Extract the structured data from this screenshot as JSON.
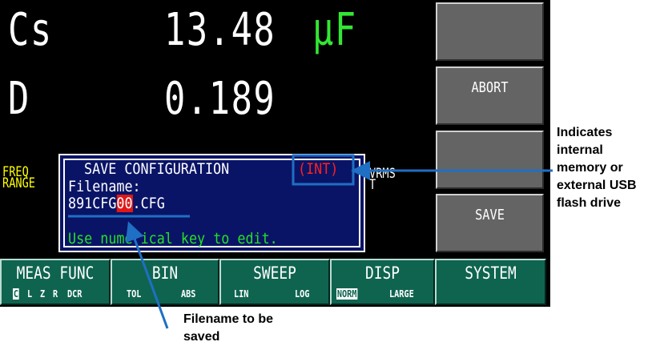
{
  "readings": {
    "param1": "Cs",
    "value1": "13.48",
    "unit1": "µF",
    "param2": "D",
    "value2": "0.189"
  },
  "labels": {
    "freq": "FREQ",
    "range": "RANGE",
    "vrms": "VRMS",
    "t": "T"
  },
  "side_buttons": [
    "",
    "ABORT",
    "",
    "SAVE"
  ],
  "dialog": {
    "title": "SAVE CONFIGURATION",
    "storage": "(INT)",
    "filename_label": "Filename:",
    "filename_prefix": "891CFG",
    "filename_cursor": "00",
    "filename_suffix": ".CFG",
    "hint": "Use numerical key to edit."
  },
  "bottom_menu": {
    "meas_func": {
      "label": "MEAS FUNC",
      "options": [
        "C",
        "L",
        "Z",
        "R",
        "DCR"
      ]
    },
    "bin": {
      "label": "BIN",
      "options": [
        "TOL",
        "ABS"
      ]
    },
    "sweep": {
      "label": "SWEEP",
      "options": [
        "LIN",
        "LOG"
      ]
    },
    "disp": {
      "label": "DISP",
      "options": [
        "NORM",
        "LARGE"
      ]
    },
    "system": {
      "label": "SYSTEM"
    }
  },
  "annotations": {
    "storage": "Indicates internal memory or external USB flash drive",
    "filename": "Filename to be saved"
  },
  "colors": {
    "screen_bg": "#000000",
    "unit_green": "#33e633",
    "freq_yellow": "#ffff00",
    "dialog_bg": "#0a1466",
    "int_red": "#ff2020",
    "hint_green": "#26e026",
    "menu_teal": "#0f6450",
    "side_gray": "#646464",
    "annotation_blue": "#1f6fc4"
  }
}
